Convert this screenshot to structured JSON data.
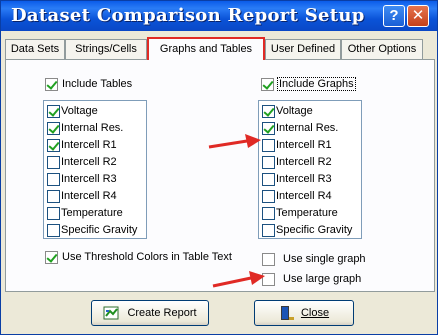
{
  "window": {
    "title": "Dataset Comparison Report Setup",
    "help_glyph": "?",
    "close_glyph": "✕"
  },
  "tabs": [
    {
      "label": "Data Sets"
    },
    {
      "label": "Strings/Cells"
    },
    {
      "label": "Graphs and Tables",
      "active": true
    },
    {
      "label": "User Defined"
    },
    {
      "label": "Other Options"
    }
  ],
  "tables": {
    "include_label": "Include Tables",
    "include_checked": true,
    "items": [
      {
        "label": "Voltage",
        "checked": true
      },
      {
        "label": "Internal Res.",
        "checked": true
      },
      {
        "label": "Intercell R1",
        "checked": true
      },
      {
        "label": "Intercell R2",
        "checked": false
      },
      {
        "label": "Intercell R3",
        "checked": false
      },
      {
        "label": "Intercell R4",
        "checked": false
      },
      {
        "label": "Temperature",
        "checked": false
      },
      {
        "label": "Specific Gravity",
        "checked": false
      }
    ],
    "threshold_label": "Use Threshold Colors in Table Text",
    "threshold_checked": true
  },
  "graphs": {
    "include_label": "Include Graphs",
    "include_checked": true,
    "items": [
      {
        "label": "Voltage",
        "checked": true
      },
      {
        "label": "Internal Res.",
        "checked": true
      },
      {
        "label": "Intercell R1",
        "checked": false
      },
      {
        "label": "Intercell R2",
        "checked": false
      },
      {
        "label": "Intercell R3",
        "checked": false
      },
      {
        "label": "Intercell R4",
        "checked": false
      },
      {
        "label": "Temperature",
        "checked": false
      },
      {
        "label": "Specific Gravity",
        "checked": false
      }
    ],
    "single_graph_label": "Use single graph",
    "single_graph_checked": false,
    "large_graph_label": "Use large graph",
    "large_graph_checked": false
  },
  "buttons": {
    "create_report": "Create Report",
    "close": "Close"
  },
  "colors": {
    "titlebar": "#0a53d8",
    "highlight": "#e02a25",
    "arrow": "#e02a25",
    "check": "#21a121"
  }
}
